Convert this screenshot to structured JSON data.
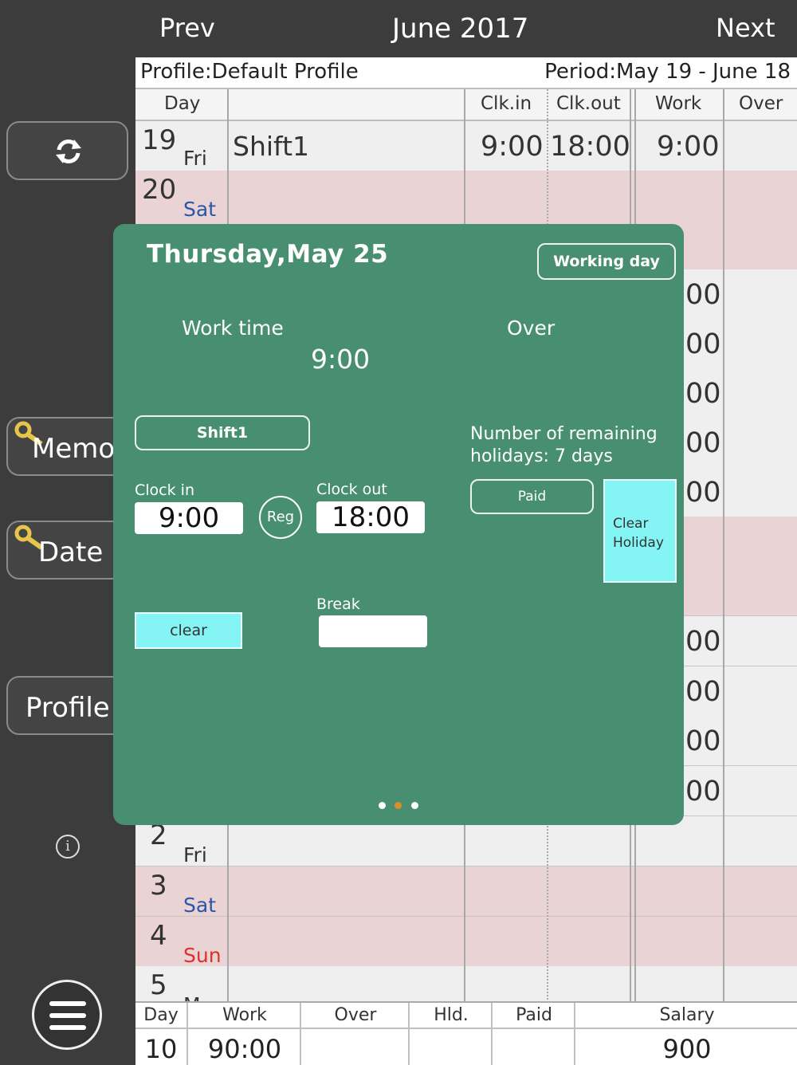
{
  "topbar": {
    "prev": "Prev",
    "title": "June 2017",
    "next": "Next"
  },
  "sidebar": {
    "memo": "Memo",
    "date": "Date",
    "profile": "Profile"
  },
  "table": {
    "profile": "Profile:Default Profile",
    "period": "Period:May 19 - June 18",
    "headers": {
      "day": "Day",
      "clkin": "Clk.in",
      "clkout": "Clk.out",
      "work": "Work",
      "over": "Over"
    },
    "rows": {
      "r19": {
        "num": "19",
        "day": "Fri",
        "shift": "Shift1",
        "clkin": "9:00",
        "clkout": "18:00",
        "work": "9:00"
      },
      "r20": {
        "num": "20",
        "day": "Sat"
      },
      "r2": {
        "num": "2",
        "day": "Fri"
      },
      "r3": {
        "num": "3",
        "day": "Sat"
      },
      "r4": {
        "num": "4",
        "day": "Sun"
      },
      "r5": {
        "num": "5",
        "day": "M"
      }
    },
    "partial_work": "00"
  },
  "footer": {
    "day": {
      "h": "Day",
      "v": "10"
    },
    "work": {
      "h": "Work",
      "v": "90:00"
    },
    "over": {
      "h": "Over",
      "v": ""
    },
    "hld": {
      "h": "Hld.",
      "v": ""
    },
    "paid": {
      "h": "Paid",
      "v": ""
    },
    "salary": {
      "h": "Salary",
      "v": "900"
    }
  },
  "modal": {
    "date": "Thursday,May 25",
    "working_day": "Working day",
    "work_time_label": "Work time",
    "work_time_value": "9:00",
    "over_label": "Over",
    "shift": "Shift1",
    "remaining": "Number of remaining holidays: 7 days",
    "clock_in_label": "Clock in",
    "clock_in": "9:00",
    "reg": "Reg",
    "clock_out_label": "Clock out",
    "clock_out": "18:00",
    "paid": "Paid",
    "clear_holiday": "Clear Holiday",
    "clear": "clear",
    "break_label": "Break",
    "break_value": ""
  },
  "colors": {
    "modal": "#488f72",
    "weekend": "#e9d3d4",
    "cyan": "#84f4f4",
    "sat": "#2a56a8",
    "sun": "#e0302c",
    "active_dot": "#d9902a"
  }
}
